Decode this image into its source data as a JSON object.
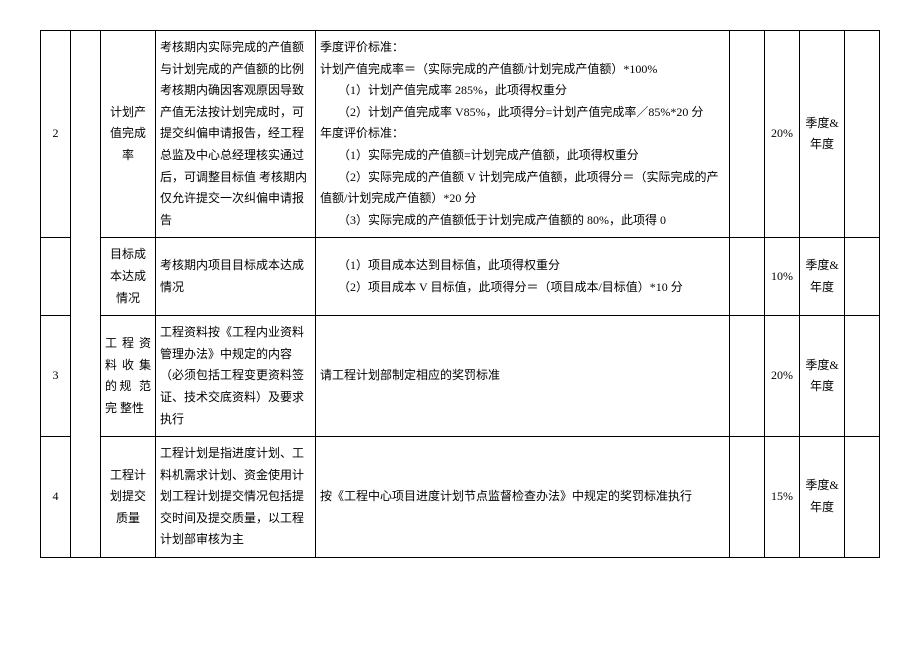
{
  "rows": [
    {
      "num": "2",
      "indicator": "计划产值完成率",
      "desc": "考核期内实际完成的产值额与计划完成的产值额的比例考核期内确因客观原因导致产值无法按计划完成时，可提交纠偏申请报告，经工程总监及中心总经理核实通过后，可调整目标值\n考核期内仅允许提交一次纠偏申请报告",
      "criteria": "季度评价标准：\n计划产值完成率＝（实际完成的产值额/计划完成产值额）*100%\n（1）计划产值完成率 285%，此项得权重分\n（2）计划产值完成率 V85%，此项得分=计划产值完成率／85%*20 分\n年度评价标准：\n（1）实际完成的产值额=计划完成产值额，此项得权重分\n（2）实际完成的产值额 V 计划完成产值额，此项得分＝（实际完成的产值额/计划完成产值额）*20 分\n（3）实际完成的产值额低于计划完成产值额的 80%，此项得 0",
      "weight": "20%",
      "period": "季度&年度"
    },
    {
      "num": "",
      "indicator": "目标成本达成情况",
      "desc": "考核期内项目目标成本达成情况",
      "criteria": "（1）项目成本达到目标值，此项得权重分\n（2）项目成本 V 目标值，此项得分＝（项目成本/目标值）*10 分",
      "weight": "10%",
      "period": "季度&年度"
    },
    {
      "num": "3",
      "indicator": "工 程 资料 收 集 的规 范 完 整性",
      "desc": "工程资料按《工程内业资料管理办法》中规定的内容（必须包括工程变更资料签证、技术交底资料）及要求执行",
      "criteria": "请工程计划部制定相应的奖罚标准",
      "weight": "20%",
      "period": "季度&年度"
    },
    {
      "num": "4",
      "indicator": "工程计划提交质量",
      "desc": "工程计划是指进度计划、工料机需求计划、资金使用计划工程计划提交情况包括提交时间及提交质量，以工程计划部审核为主",
      "criteria": "按《工程中心项目进度计划节点监督检查办法》中规定的奖罚标准执行",
      "weight": "15%",
      "period": "季度&年度"
    }
  ]
}
